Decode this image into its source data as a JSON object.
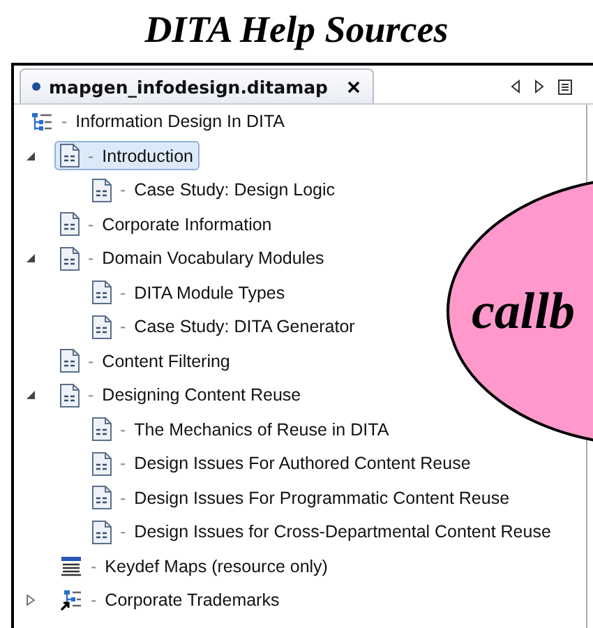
{
  "title": "DITA Help Sources",
  "tab": {
    "label": "mapgen_infodesign.ditamap",
    "modified": true,
    "selected": true
  },
  "tree": {
    "kind": "map",
    "prefix": "-",
    "label": "Information Design In DITA",
    "selected": false,
    "children": [
      {
        "kind": "topic",
        "prefix": "-",
        "label": "Introduction",
        "selected": true,
        "expanded": true,
        "children": [
          {
            "kind": "topic",
            "prefix": "-",
            "label": "Case Study: Design Logic",
            "selected": false
          }
        ]
      },
      {
        "kind": "topic",
        "prefix": "-",
        "label": "Corporate Information",
        "selected": false
      },
      {
        "kind": "topic",
        "prefix": "-",
        "label": "Domain Vocabulary Modules",
        "selected": false,
        "expanded": true,
        "children": [
          {
            "kind": "topic",
            "prefix": "-",
            "label": "DITA Module Types",
            "selected": false
          },
          {
            "kind": "topic",
            "prefix": "-",
            "label": "Case Study: DITA Generator",
            "selected": false
          }
        ]
      },
      {
        "kind": "topic",
        "prefix": "-",
        "label": "Content Filtering",
        "selected": false
      },
      {
        "kind": "topic",
        "prefix": "-",
        "label": "Designing Content Reuse",
        "selected": false,
        "expanded": true,
        "children": [
          {
            "kind": "topic",
            "prefix": "-",
            "label": "The Mechanics of Reuse in DITA",
            "selected": false
          },
          {
            "kind": "topic",
            "prefix": "-",
            "label": "Design Issues For Authored Content Reuse",
            "selected": false
          },
          {
            "kind": "topic",
            "prefix": "-",
            "label": "Design Issues For Programmatic Content Reuse",
            "selected": false
          },
          {
            "kind": "topic",
            "prefix": "-",
            "label": "Design Issues for Cross-Departmental Content Reuse",
            "selected": false
          }
        ]
      },
      {
        "kind": "keydef",
        "prefix": "-",
        "label": "Keydef Maps (resource only)",
        "selected": false
      },
      {
        "kind": "mapref",
        "prefix": "-",
        "label": "Corporate Trademarks",
        "selected": false,
        "expanded": false
      }
    ]
  },
  "callout": {
    "text": "callb"
  }
}
